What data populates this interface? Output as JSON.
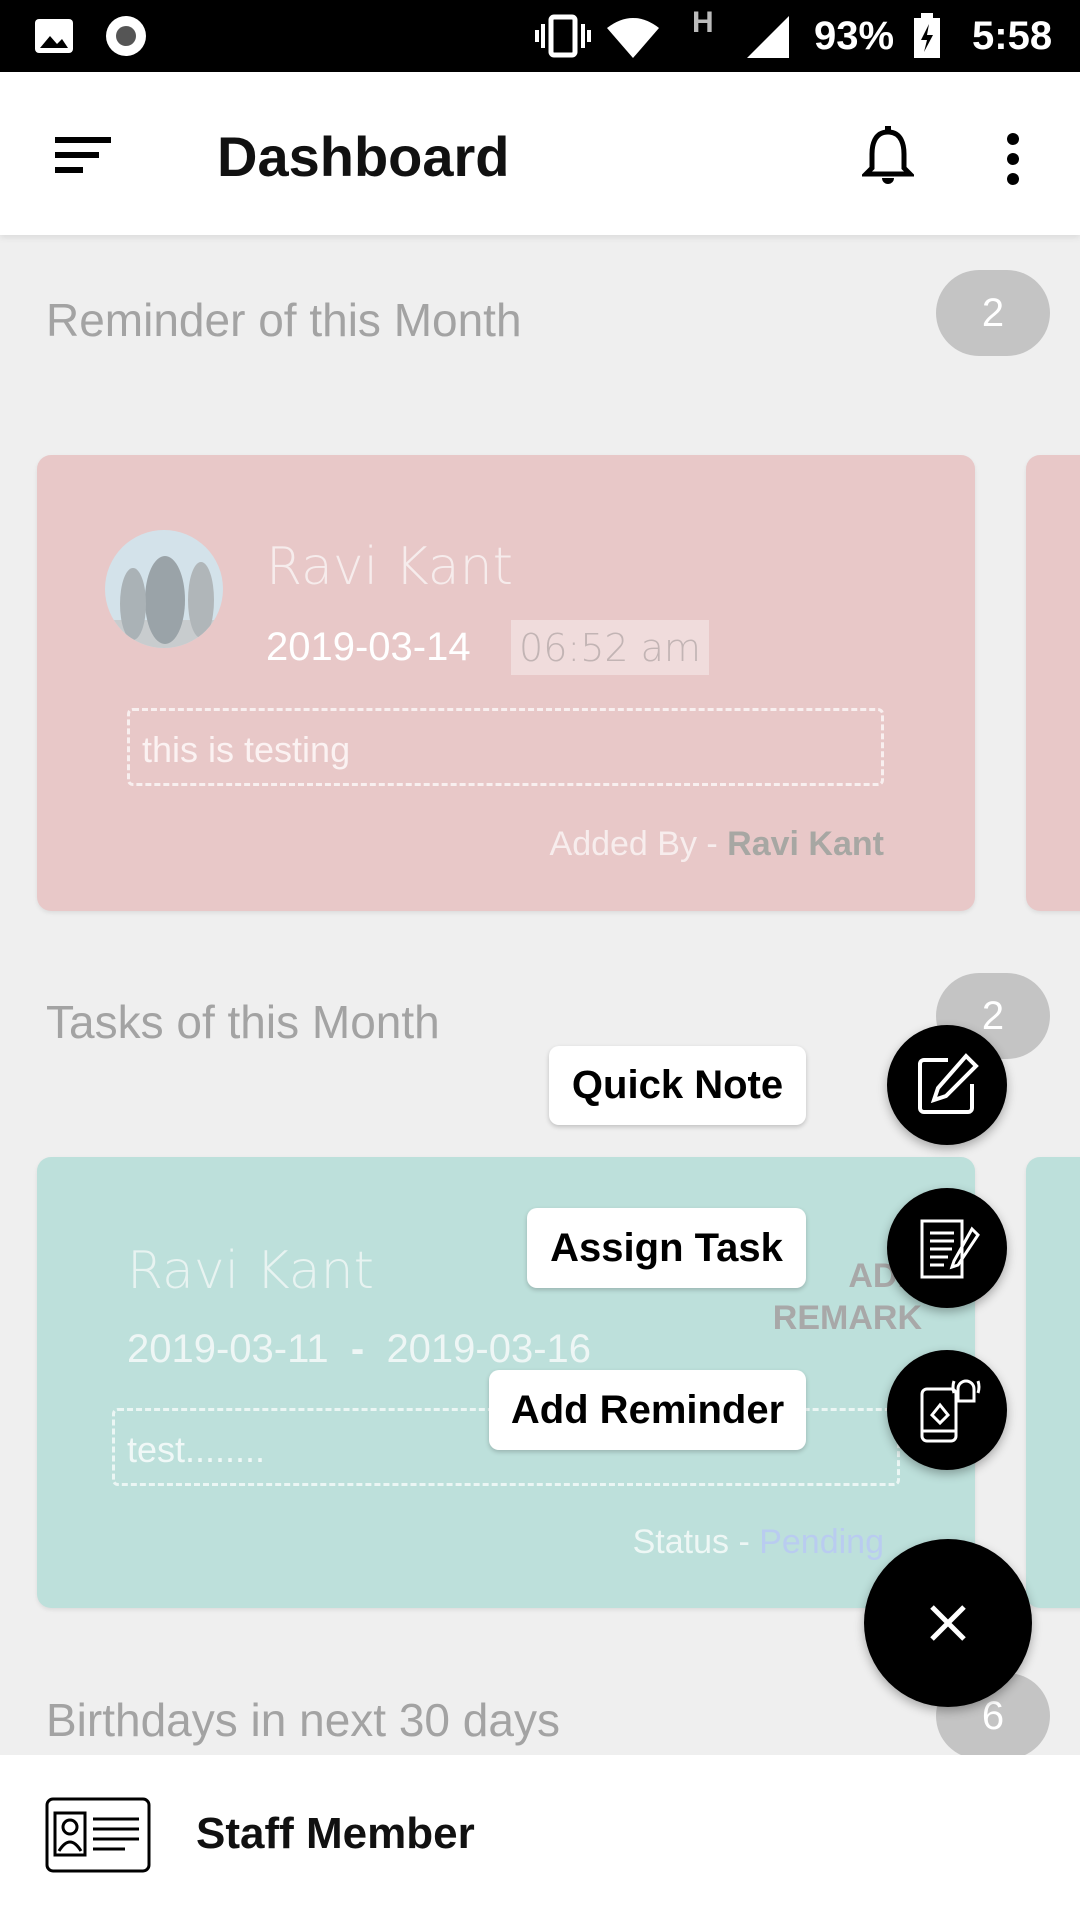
{
  "status_bar": {
    "battery": "93%",
    "time": "5:58",
    "network": "H"
  },
  "header": {
    "title": "Dashboard"
  },
  "reminders": {
    "title": "Reminder of this Month",
    "count": "2",
    "card": {
      "name": "Ravi Kant",
      "date": "2019-03-14",
      "time": "06:52 am",
      "note": "this is testing",
      "added_by_label": "Added By - ",
      "added_by": "Ravi Kant"
    }
  },
  "tasks": {
    "title": "Tasks of this Month",
    "count": "2",
    "card": {
      "name": "Ravi Kant",
      "start": "2019-03-11",
      "sep": "-",
      "end": "2019-03-16",
      "note": "test........",
      "status_label": "Status - ",
      "status": "Pending",
      "remark_button": "ADD REMARK"
    }
  },
  "birthdays": {
    "title": "Birthdays in next 30 days",
    "count": "6"
  },
  "fab_menu": {
    "quick_note": "Quick Note",
    "assign_task": "Assign Task",
    "add_reminder": "Add Reminder"
  },
  "bottom": {
    "label": "Staff Member"
  },
  "colors": {
    "reminder_card": "#e8c8c8",
    "task_card": "#bde0db",
    "pending": "#b9ccf0"
  }
}
